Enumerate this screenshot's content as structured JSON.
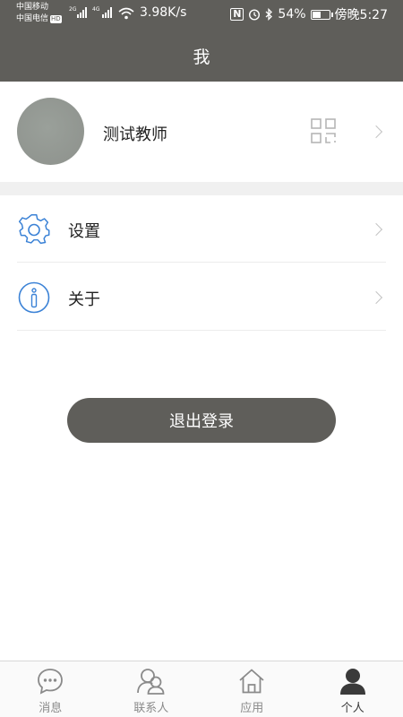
{
  "status_bar": {
    "carrier1": "中国移动",
    "carrier2": "中国电信",
    "hd": "HD",
    "net1": "2G",
    "net2": "4G",
    "speed": "3.98K/s",
    "nfc": "N",
    "battery_pct": "54%",
    "time": "傍晚5:27",
    "battery_level": 0.54
  },
  "header": {
    "title": "我"
  },
  "profile": {
    "name": "测试教师"
  },
  "menu": [
    {
      "label": "设置",
      "icon": "gear-icon"
    },
    {
      "label": "关于",
      "icon": "info-icon"
    }
  ],
  "logout": {
    "label": "退出登录"
  },
  "tabs": [
    {
      "label": "消息",
      "icon": "chat-bubble-icon",
      "active": false
    },
    {
      "label": "联系人",
      "icon": "contacts-icon",
      "active": false
    },
    {
      "label": "应用",
      "icon": "home-icon",
      "active": false
    },
    {
      "label": "个人",
      "icon": "person-icon",
      "active": true
    }
  ],
  "colors": {
    "header_bg": "#5f5e5a",
    "icon_blue": "#3b82d6",
    "tab_inactive": "#8a8a8a",
    "tab_active": "#3a3a3a"
  }
}
